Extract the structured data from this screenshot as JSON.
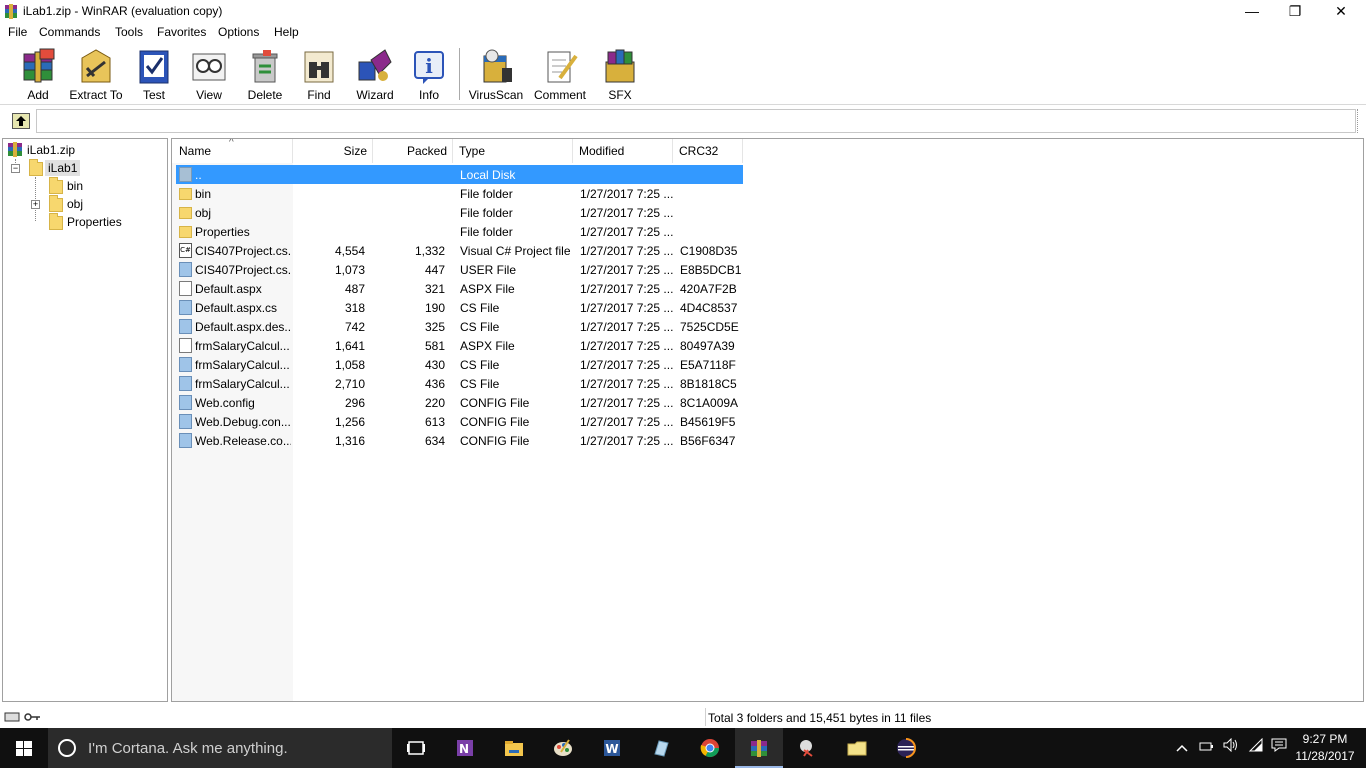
{
  "window": {
    "title": "iLab1.zip - WinRAR (evaluation copy)",
    "minimize_glyph": "—",
    "maximize_glyph": "❐",
    "close_glyph": "✕"
  },
  "menu": [
    "File",
    "Commands",
    "Tools",
    "Favorites",
    "Options",
    "Help"
  ],
  "toolbar": [
    {
      "label": "Add",
      "icon": "add-archive-icon"
    },
    {
      "label": "Extract To",
      "icon": "extract-icon"
    },
    {
      "label": "Test",
      "icon": "test-icon"
    },
    {
      "label": "View",
      "icon": "view-icon"
    },
    {
      "label": "Delete",
      "icon": "delete-icon"
    },
    {
      "label": "Find",
      "icon": "find-icon"
    },
    {
      "label": "Wizard",
      "icon": "wizard-icon"
    },
    {
      "label": "Info",
      "icon": "info-icon"
    },
    {
      "label": "VirusScan",
      "icon": "virusscan-icon"
    },
    {
      "label": "Comment",
      "icon": "comment-icon"
    },
    {
      "label": "SFX",
      "icon": "sfx-icon"
    }
  ],
  "tree": {
    "root": "iLab1.zip",
    "folder": "iLab1",
    "children": [
      "bin",
      "obj",
      "Properties"
    ]
  },
  "columns": [
    "Name",
    "Size",
    "Packed",
    "Type",
    "Modified",
    "CRC32"
  ],
  "rows": [
    {
      "name": "..",
      "size": "",
      "packed": "",
      "type": "Local Disk",
      "modified": "",
      "crc": "",
      "icon": "up"
    },
    {
      "name": "bin",
      "size": "",
      "packed": "",
      "type": "File folder",
      "modified": "1/27/2017 7:25 ...",
      "crc": "",
      "icon": "folder"
    },
    {
      "name": "obj",
      "size": "",
      "packed": "",
      "type": "File folder",
      "modified": "1/27/2017 7:25 ...",
      "crc": "",
      "icon": "folder"
    },
    {
      "name": "Properties",
      "size": "",
      "packed": "",
      "type": "File folder",
      "modified": "1/27/2017 7:25 ...",
      "crc": "",
      "icon": "folder"
    },
    {
      "name": "CIS407Project.cs...",
      "size": "4,554",
      "packed": "1,332",
      "type": "Visual C# Project file",
      "modified": "1/27/2017 7:25 ...",
      "crc": "C1908D35",
      "icon": "csproj"
    },
    {
      "name": "CIS407Project.cs...",
      "size": "1,073",
      "packed": "447",
      "type": "USER File",
      "modified": "1/27/2017 7:25 ...",
      "crc": "E8B5DCB1",
      "icon": "file"
    },
    {
      "name": "Default.aspx",
      "size": "487",
      "packed": "321",
      "type": "ASPX File",
      "modified": "1/27/2017 7:25 ...",
      "crc": "420A7F2B",
      "icon": "blank"
    },
    {
      "name": "Default.aspx.cs",
      "size": "318",
      "packed": "190",
      "type": "CS File",
      "modified": "1/27/2017 7:25 ...",
      "crc": "4D4C8537",
      "icon": "file"
    },
    {
      "name": "Default.aspx.des...",
      "size": "742",
      "packed": "325",
      "type": "CS File",
      "modified": "1/27/2017 7:25 ...",
      "crc": "7525CD5E",
      "icon": "file"
    },
    {
      "name": "frmSalaryCalcul...",
      "size": "1,641",
      "packed": "581",
      "type": "ASPX File",
      "modified": "1/27/2017 7:25 ...",
      "crc": "80497A39",
      "icon": "blank"
    },
    {
      "name": "frmSalaryCalcul...",
      "size": "1,058",
      "packed": "430",
      "type": "CS File",
      "modified": "1/27/2017 7:25 ...",
      "crc": "E5A7118F",
      "icon": "file"
    },
    {
      "name": "frmSalaryCalcul...",
      "size": "2,710",
      "packed": "436",
      "type": "CS File",
      "modified": "1/27/2017 7:25 ...",
      "crc": "8B1818C5",
      "icon": "file"
    },
    {
      "name": "Web.config",
      "size": "296",
      "packed": "220",
      "type": "CONFIG File",
      "modified": "1/27/2017 7:25 ...",
      "crc": "8C1A009A",
      "icon": "file"
    },
    {
      "name": "Web.Debug.con...",
      "size": "1,256",
      "packed": "613",
      "type": "CONFIG File",
      "modified": "1/27/2017 7:25 ...",
      "crc": "B45619F5",
      "icon": "file"
    },
    {
      "name": "Web.Release.co...",
      "size": "1,316",
      "packed": "634",
      "type": "CONFIG File",
      "modified": "1/27/2017 7:25 ...",
      "crc": "B56F6347",
      "icon": "file"
    }
  ],
  "status": {
    "summary": "Total 3 folders and 15,451 bytes in 11 files"
  },
  "taskbar": {
    "cortana_placeholder": "I'm Cortana. Ask me anything.",
    "apps": [
      "task-view-icon",
      "onenote-icon",
      "file-explorer-icon",
      "paint-icon",
      "word-icon",
      "notepad-icon",
      "chrome-icon",
      "winrar-icon",
      "snipping-icon",
      "folder-icon",
      "eclipse-icon"
    ],
    "time": "9:27 PM",
    "date": "11/28/2017"
  },
  "colors": {
    "selection": "#3399ff",
    "taskbar": "#101010"
  }
}
